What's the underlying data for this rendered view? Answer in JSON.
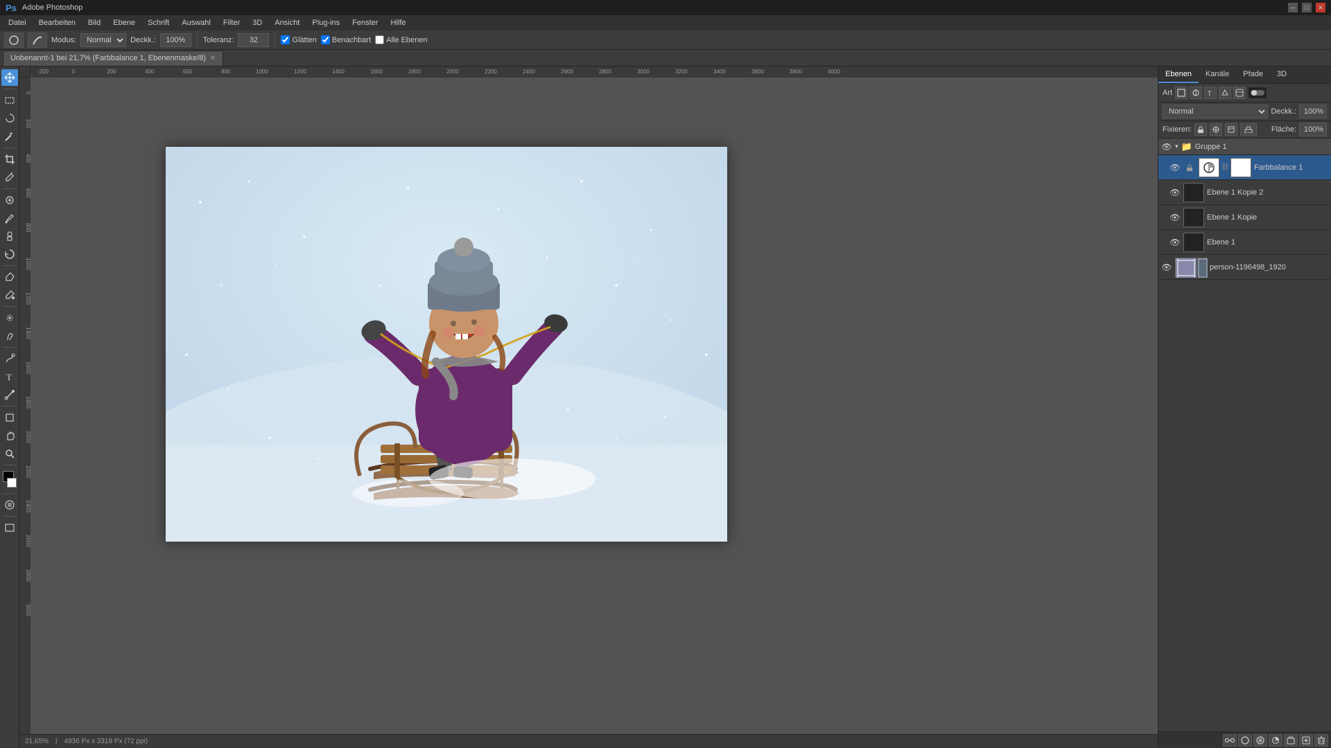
{
  "titleBar": {
    "title": "Adobe Photoshop",
    "minBtn": "─",
    "maxBtn": "□",
    "closeBtn": "✕"
  },
  "menuBar": {
    "items": [
      "Datei",
      "Bearbeiten",
      "Bild",
      "Ebene",
      "Schrift",
      "Auswahl",
      "Filter",
      "3D",
      "Ansicht",
      "Plug-ins",
      "Fenster",
      "Hilfe"
    ]
  },
  "optionsBar": {
    "modeLabel": "Modus:",
    "modeValue": "Normal",
    "opacityLabel": "Deckk.:",
    "opacityValue": "100%",
    "toleranceLabel": "Toleranz:",
    "toleranceValue": "32",
    "smoothLabel": "Glätten",
    "adjacentLabel": "Benachbart",
    "allLayersLabel": "Alle Ebenen"
  },
  "tab": {
    "label": "Unbenannt-1 bei 21,7% (Farbbalance 1, Ebenenmaske/8)",
    "closeBtn": "✕"
  },
  "canvas": {
    "zoom": "21,65%",
    "dimensions": "4936 Px x 3319 Px (72 ppi)"
  },
  "layersPanel": {
    "tabs": [
      {
        "label": "Ebenen",
        "active": true
      },
      {
        "label": "Kanäle"
      },
      {
        "label": "Pfade"
      },
      {
        "label": "3D"
      }
    ],
    "filterLabel": "Art",
    "blendMode": "Normal",
    "opacity": "100%",
    "fill": "100%",
    "lockLabel": "Fixieren:",
    "layers": [
      {
        "id": "gruppe1",
        "type": "group",
        "name": "Gruppe 1",
        "visible": true,
        "expanded": true
      },
      {
        "id": "farbbalance1",
        "type": "adjustment",
        "name": "Farbbalance 1",
        "visible": true,
        "locked": false,
        "selected": true,
        "hasChain": true
      },
      {
        "id": "ebene1kopie2",
        "type": "pixel",
        "name": "Ebene 1 Kopie 2",
        "visible": true
      },
      {
        "id": "ebene1kopie",
        "type": "pixel",
        "name": "Ebene 1 Kopie",
        "visible": true
      },
      {
        "id": "ebene1",
        "type": "pixel",
        "name": "Ebene 1",
        "visible": true
      },
      {
        "id": "person1",
        "type": "smart",
        "name": "person-1196498_1920",
        "visible": true
      }
    ]
  },
  "statusBar": {
    "zoom": "21,65%",
    "dimensions": "4936 Px x 3319 Px (72 ppi)"
  }
}
